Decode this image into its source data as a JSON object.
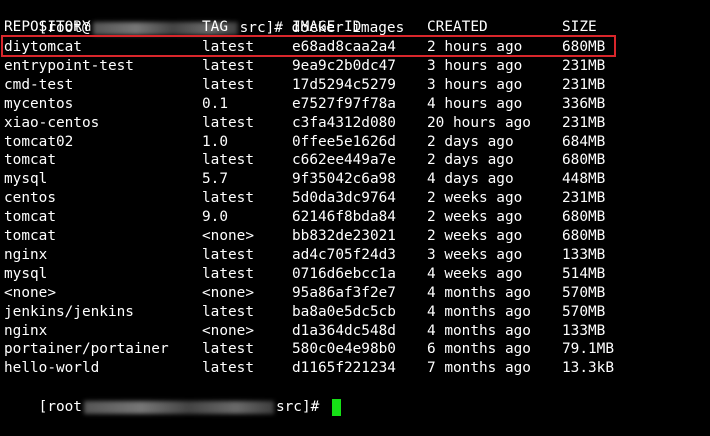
{
  "prompt": {
    "open": "[root@",
    "dir": "src]# ",
    "command": "docker images"
  },
  "columns": {
    "repository": "REPOSITORY",
    "tag": "TAG",
    "image_id": "IMAGE ID",
    "created": "CREATED",
    "size": "SIZE"
  },
  "rows": [
    {
      "repository": "diytomcat",
      "tag": "latest",
      "image_id": "e68ad8caa2a4",
      "created": "2 hours ago",
      "size": "680MB"
    },
    {
      "repository": "entrypoint-test",
      "tag": "latest",
      "image_id": "9ea9c2b0dc47",
      "created": "3 hours ago",
      "size": "231MB"
    },
    {
      "repository": "cmd-test",
      "tag": "latest",
      "image_id": "17d5294c5279",
      "created": "3 hours ago",
      "size": "231MB"
    },
    {
      "repository": "mycentos",
      "tag": "0.1",
      "image_id": "e7527f97f78a",
      "created": "4 hours ago",
      "size": "336MB"
    },
    {
      "repository": "xiao-centos",
      "tag": "latest",
      "image_id": "c3fa4312d080",
      "created": "20 hours ago",
      "size": "231MB"
    },
    {
      "repository": "tomcat02",
      "tag": "1.0",
      "image_id": "0ffee5e1626d",
      "created": "2 days ago",
      "size": "684MB"
    },
    {
      "repository": "tomcat",
      "tag": "latest",
      "image_id": "c662ee449a7e",
      "created": "2 days ago",
      "size": "680MB"
    },
    {
      "repository": "mysql",
      "tag": "5.7",
      "image_id": "9f35042c6a98",
      "created": "4 days ago",
      "size": "448MB"
    },
    {
      "repository": "centos",
      "tag": "latest",
      "image_id": "5d0da3dc9764",
      "created": "2 weeks ago",
      "size": "231MB"
    },
    {
      "repository": "tomcat",
      "tag": "9.0",
      "image_id": "62146f8bda84",
      "created": "2 weeks ago",
      "size": "680MB"
    },
    {
      "repository": "tomcat",
      "tag": "<none>",
      "image_id": "bb832de23021",
      "created": "2 weeks ago",
      "size": "680MB"
    },
    {
      "repository": "nginx",
      "tag": "latest",
      "image_id": "ad4c705f24d3",
      "created": "3 weeks ago",
      "size": "133MB"
    },
    {
      "repository": "mysql",
      "tag": "latest",
      "image_id": "0716d6ebcc1a",
      "created": "4 weeks ago",
      "size": "514MB"
    },
    {
      "repository": "<none>",
      "tag": "<none>",
      "image_id": "95a86af3f2e7",
      "created": "4 months ago",
      "size": "570MB"
    },
    {
      "repository": "jenkins/jenkins",
      "tag": "latest",
      "image_id": "ba8a0e5dc5cb",
      "created": "4 months ago",
      "size": "570MB"
    },
    {
      "repository": "nginx",
      "tag": "<none>",
      "image_id": "d1a364dc548d",
      "created": "4 months ago",
      "size": "133MB"
    },
    {
      "repository": "portainer/portainer",
      "tag": "latest",
      "image_id": "580c0e4e98b0",
      "created": "6 months ago",
      "size": "79.1MB"
    },
    {
      "repository": "hello-world",
      "tag": "latest",
      "image_id": "d1165f221234",
      "created": "7 months ago",
      "size": "13.3kB"
    }
  ],
  "prompt_end": {
    "open": "[root",
    "dir": "src]# "
  },
  "colors": {
    "background": "#000000",
    "text": "#ffffff",
    "highlight_border": "#d9262b",
    "cursor": "#16e016"
  }
}
